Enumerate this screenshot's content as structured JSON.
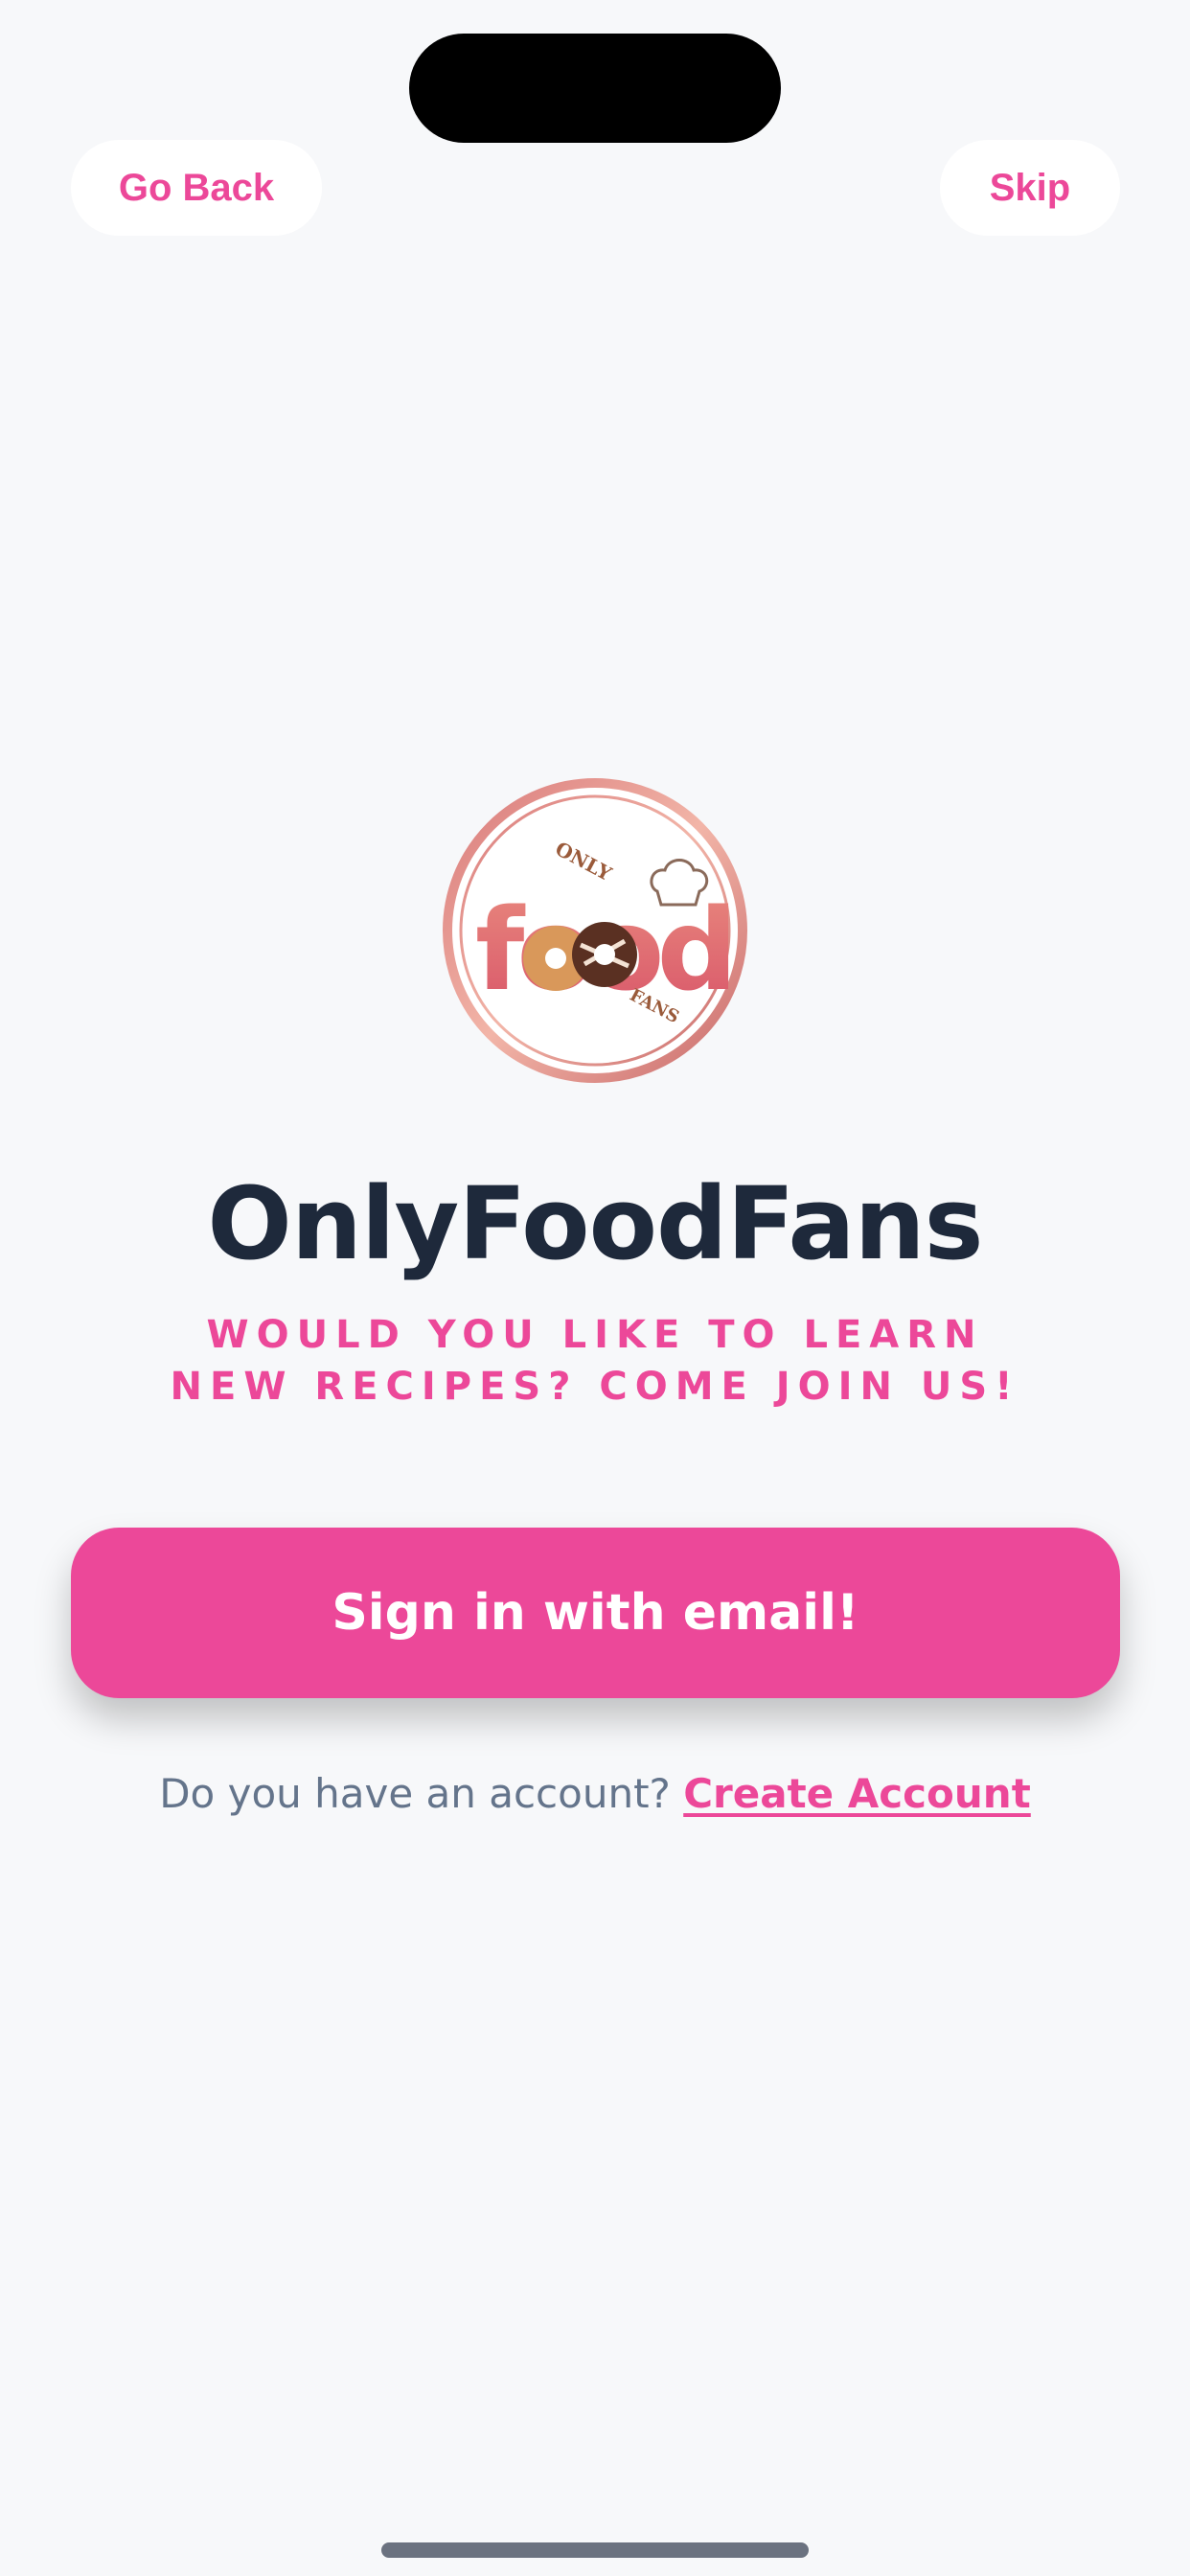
{
  "header": {
    "back_label": "Go Back",
    "skip_label": "Skip"
  },
  "logo": {
    "word": "food",
    "top_text": "ONLY",
    "bottom_text": "FANS"
  },
  "app": {
    "title": "OnlyFoodFans",
    "tagline": "WOULD YOU LIKE TO LEARN NEW RECIPES? COME JOIN US!"
  },
  "signin": {
    "label": "Sign in with email!"
  },
  "account": {
    "prompt": "Do you have an account?",
    "link_label": "Create Account"
  },
  "colors": {
    "accent": "#ec4899",
    "title": "#1e293b",
    "muted": "#64748b",
    "background": "#f7f8fa"
  },
  "icons": [
    "food-fans-logo-icon",
    "chef-hat-icon",
    "donut-icon"
  ]
}
